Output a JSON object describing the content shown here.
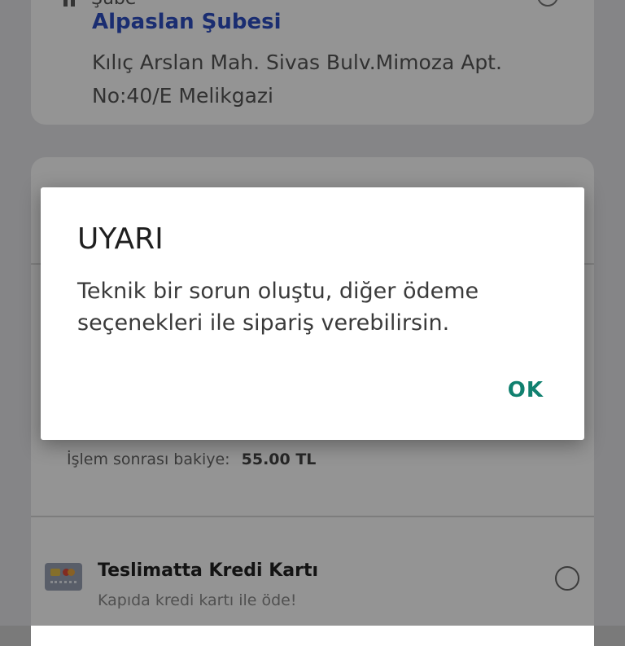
{
  "branch": {
    "label": "Şube",
    "name": "Alpaslan Şubesi",
    "address": "Kılıç Arslan Mah. Sivas Bulv.Mimoza Apt. No:40/E  Melikgazi"
  },
  "wallet": {
    "after_balance_label": "İşlem sonrası bakiye:",
    "after_balance_value": "55.00 TL"
  },
  "payment_option": {
    "title": "Teslimatta Kredi Kartı",
    "subtitle": "Kapıda kredi kartı ile öde!",
    "icon": "credit-card-icon"
  },
  "dialog": {
    "title": "UYARI",
    "message": "Teknik bir sorun oluştu, diğer ödeme seçenekleri ile sipariş verebilirsin.",
    "ok_label": "OK"
  },
  "colors": {
    "accent": "#10806f",
    "branch_name": "#2d4fc3"
  }
}
